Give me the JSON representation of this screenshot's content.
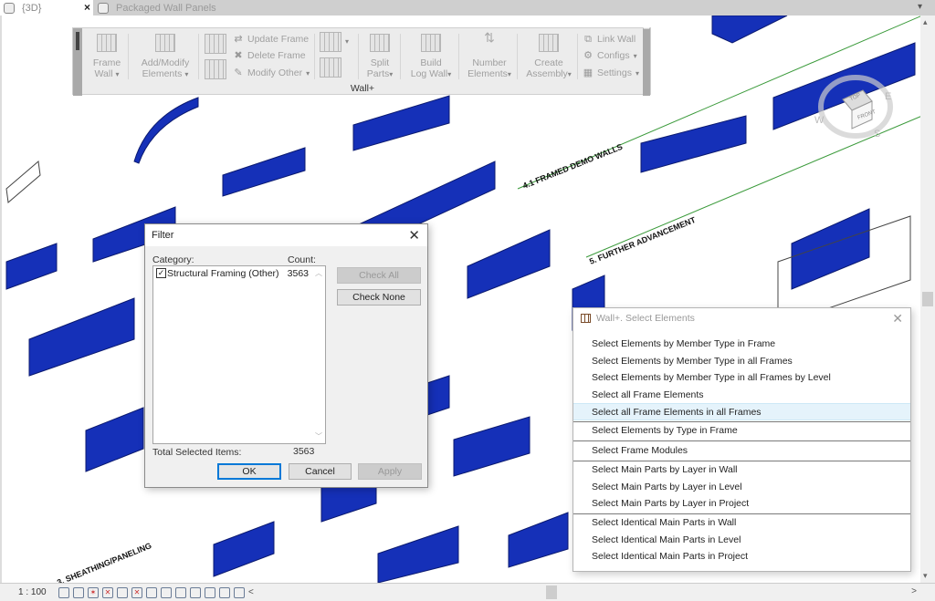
{
  "tabs": [
    {
      "label": "{3D}",
      "active": true,
      "close_label": "×"
    },
    {
      "label": "Packaged Wall Panels",
      "active": false
    }
  ],
  "ribbon": {
    "panel_title": "Wall+",
    "buttons": {
      "frame_wall": {
        "line1": "Frame",
        "line2": "Wall"
      },
      "add_modify": {
        "line1": "Add/Modify",
        "line2": "Elements"
      },
      "update_frame": "Update Frame",
      "delete_frame": "Delete Frame",
      "modify_other": "Modify Other",
      "split_parts": {
        "line1": "Split",
        "line2": "Parts"
      },
      "build_log_wall": {
        "line1": "Build",
        "line2": "Log Wall"
      },
      "number_elements": {
        "line1": "Number",
        "line2": "Elements"
      },
      "create_assembly": {
        "line1": "Create",
        "line2": "Assembly"
      },
      "link_wall": "Link Wall",
      "configs": "Configs",
      "settings": "Settings"
    },
    "dropdown_glyph": "▾"
  },
  "filter_dialog": {
    "title": "Filter",
    "close": "✕",
    "category_label": "Category:",
    "count_label": "Count:",
    "items": [
      {
        "checked": true,
        "name": "Structural Framing (Other)",
        "count": "3563"
      }
    ],
    "check_all": "Check All",
    "check_none": "Check None",
    "total_label": "Total Selected Items:",
    "total_value": "3563",
    "ok": "OK",
    "cancel": "Cancel",
    "apply": "Apply"
  },
  "select_popup": {
    "title": "Wall+. Select Elements",
    "close": "✕",
    "items": [
      "Select Elements by Member Type in Frame",
      "Select Elements by Member Type in all Frames",
      "Select Elements by Member Type in all Frames by Level",
      "Select all Frame Elements",
      "Select all Frame Elements in all Frames",
      "Select Elements by Type in Frame",
      "Select Frame Modules",
      "Select Main Parts by Layer in Wall",
      "Select Main Parts by Layer in Level",
      "Select Main Parts by Layer in Project",
      "Select Identical Main Parts in Wall",
      "Select Identical Main Parts in Level",
      "Select Identical Main Parts in Project"
    ],
    "highlighted_index": 4
  },
  "viewcube": {
    "top": "TOP",
    "front": "FRONT",
    "w": "W",
    "s": "S",
    "e": "E"
  },
  "canvas_labels": {
    "framed_demo": "4.1 FRAMED DEMO WALLS",
    "further": "5. FURTHER ADVANCEMENT",
    "sheathing": "3. SHEATHING/PANELING"
  },
  "status": {
    "scale": "1 : 100",
    "scroll_left": "<",
    "scroll_right": ">"
  },
  "colors": {
    "wall_blue": "#1530b8",
    "highlight": "#e5f3fb",
    "default_btn": "#0078d7"
  }
}
